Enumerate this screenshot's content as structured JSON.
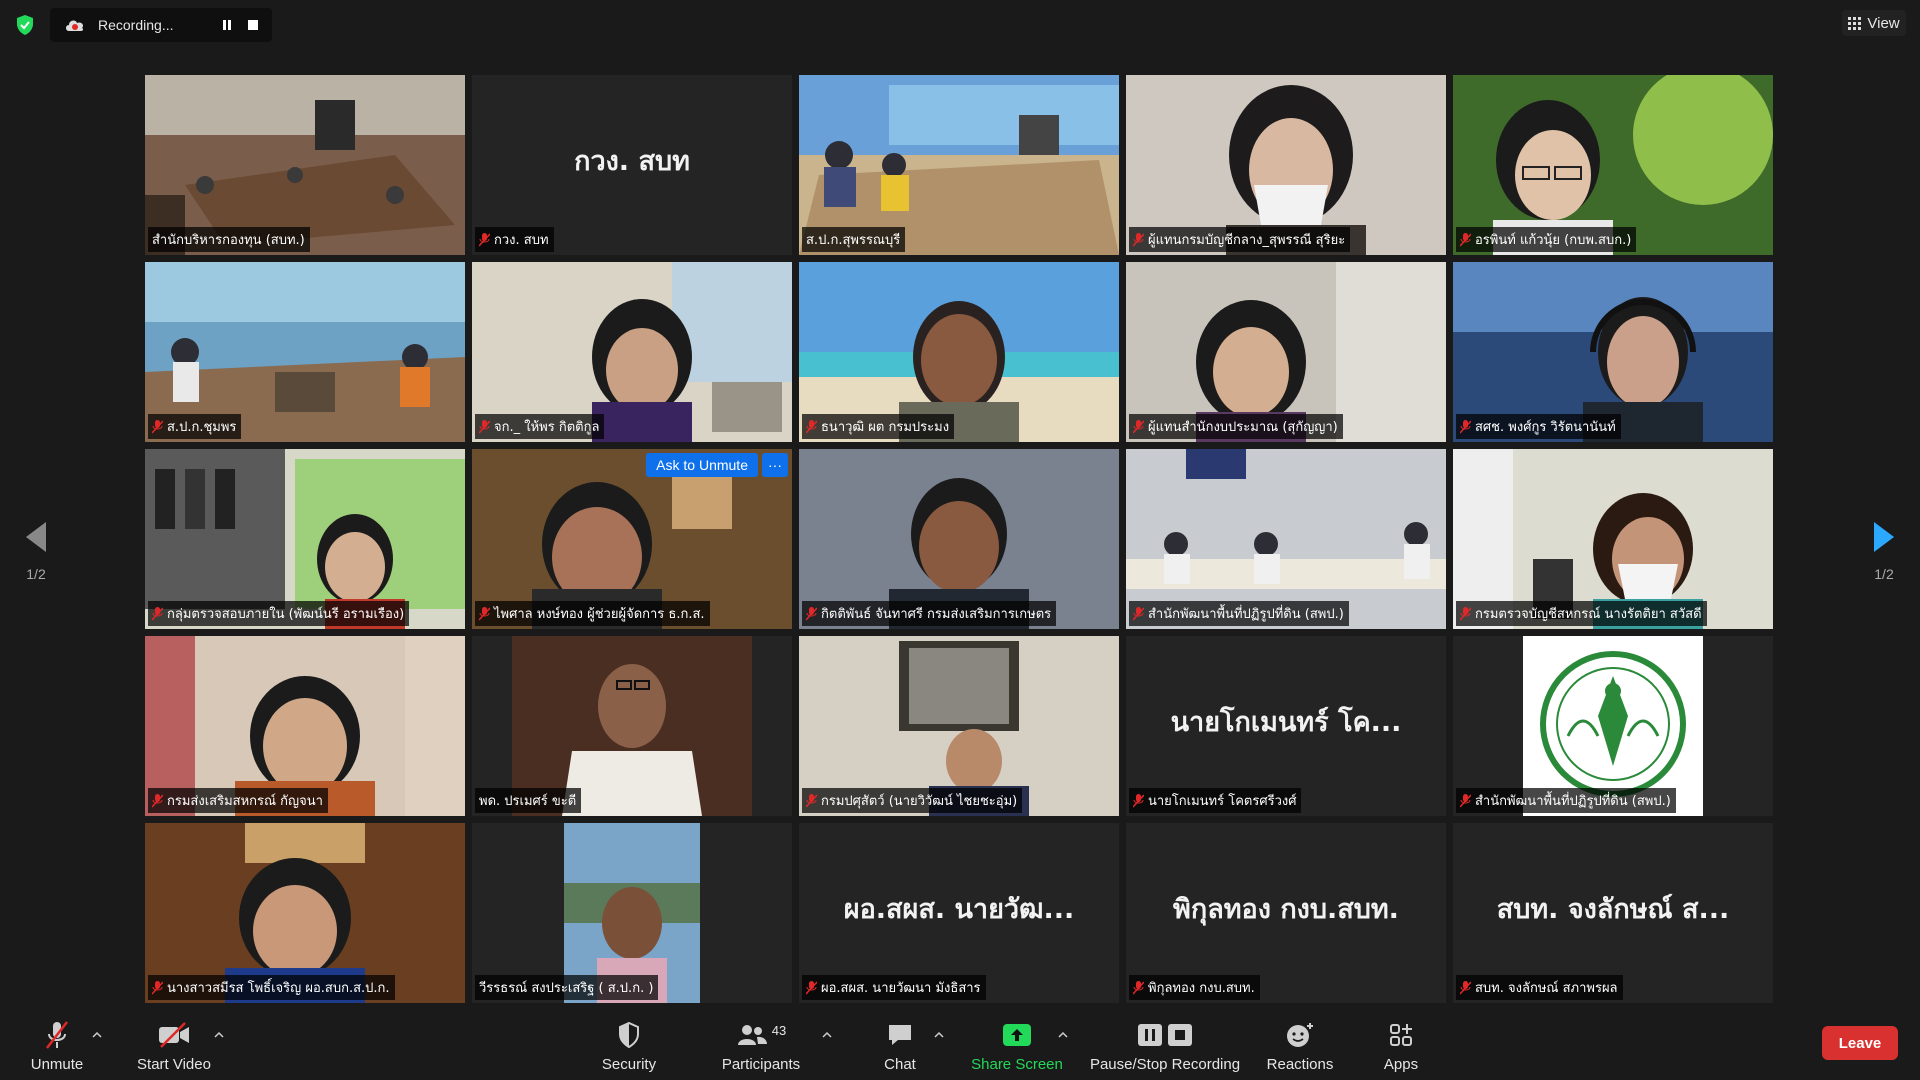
{
  "recording": {
    "label": "Recording..."
  },
  "view_label": "View",
  "tiles": [
    {
      "label": "สำนักบริหารกองทุน (สบท.)",
      "muted": false
    },
    {
      "label": "กวง. สบท",
      "muted": true,
      "big_name": "กวง. สบท"
    },
    {
      "label": "ส.ป.ก.สุพรรณบุรี",
      "muted": false
    },
    {
      "label": "ผู้แทนกรมบัญชีกลาง_สุพรรณี สุริยะ",
      "muted": true
    },
    {
      "label": "อรพินท์ แก้วนุ้ย (กบพ.สบก.)",
      "muted": true
    },
    {
      "label": "ส.ป.ก.ชุมพร",
      "muted": true
    },
    {
      "label": "จก._ ให้พร กิตติกูล",
      "muted": true
    },
    {
      "label": "ธนาวุฒิ ผต กรมประมง",
      "muted": true
    },
    {
      "label": "ผู้แทนสำนักงบประมาณ (สุกัญญา)",
      "muted": true
    },
    {
      "label": "สศช. พงศ์กูร วิรัตนานันท์",
      "muted": true
    },
    {
      "label": "กลุ่มตรวจสอบภายใน (พัฒน์นรี อรามเรือง)",
      "muted": true
    },
    {
      "label": "ไพศาล หงษ์ทอง ผู้ช่วยผู้จัดการ ธ.ก.ส.",
      "muted": true,
      "ask_unmute": "Ask to Unmute",
      "more": "···"
    },
    {
      "label": "กิตติพันธ์ จันทาศรี กรมส่งเสริมการเกษตร",
      "muted": true
    },
    {
      "label": "สำนักพัฒนาพื้นที่ปฏิรูปที่ดิน (สพป.)",
      "muted": true
    },
    {
      "label": "กรมตรวจบัญชีสหกรณ์ นางรัตติยา สวัสดี",
      "muted": true
    },
    {
      "label": "กรมส่งเสริมสหกรณ์ กัญจนา",
      "muted": true
    },
    {
      "label": "พด. ปรเมศร์ ขะตี",
      "muted": false,
      "active": true
    },
    {
      "label": "กรมปศุสัตว์ (นายวิวัฒน์ ไชยชะอุ่ม)",
      "muted": true
    },
    {
      "label": "นายโกเมนทร์ โคตรศรีวงศ์",
      "muted": true,
      "big_name": "นายโกเมนทร์ โค..."
    },
    {
      "label": "สำนักพัฒนาพื้นที่ปฏิรูปที่ดิน (สพป.)",
      "muted": true
    },
    {
      "label": "นางสาวสมีรส โพธิ์เจริญ ผอ.สบก.ส.ป.ก.",
      "muted": true
    },
    {
      "label": "วีรรธรณ์ สงประเสริฐ ( ส.ป.ก. )",
      "muted": false
    },
    {
      "label": "ผอ.สผส. นายวัฒนา มังธิสาร",
      "muted": true,
      "big_name": "ผอ.สผส. นายวัฒ..."
    },
    {
      "label": "พิกุลทอง กงบ.สบท.",
      "muted": true,
      "big_name": "พิกุลทอง กงบ.สบท."
    },
    {
      "label": "สบท. จงลักษณ์ สภาพรผล",
      "muted": true,
      "big_name": "สบท. จงลักษณ์ ส..."
    }
  ],
  "page_indicator": {
    "left": "1/2",
    "right": "1/2"
  },
  "toolbar": {
    "unmute": "Unmute",
    "start_video": "Start Video",
    "security": "Security",
    "participants": "Participants",
    "participants_count": "43",
    "chat": "Chat",
    "share_screen": "Share Screen",
    "pause_stop": "Pause/Stop Recording",
    "reactions": "Reactions",
    "apps": "Apps",
    "leave": "Leave"
  },
  "colors": {
    "accent_blue": "#0e71eb",
    "share_green": "#23d959",
    "leave_red": "#d93030",
    "active_speaker": "#c9e34a"
  }
}
